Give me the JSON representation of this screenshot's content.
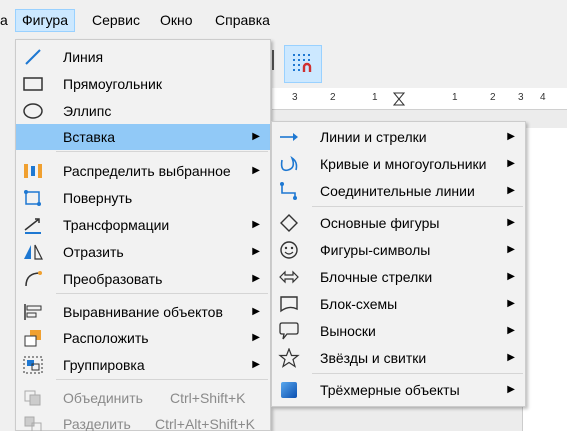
{
  "menubar": [
    "а",
    "Фигура",
    "Сервис",
    "Окно",
    "Справка"
  ],
  "toolbar": {
    "button_icon": "snap-to-grid-icon"
  },
  "ruler": {
    "labels": [
      "3",
      "2",
      "1",
      "1",
      "2",
      "3",
      "4"
    ]
  },
  "menu_shape": {
    "items": [
      {
        "label": "Линия",
        "icon": "line-icon"
      },
      {
        "label": "Прямоугольник",
        "icon": "rectangle-icon"
      },
      {
        "label": "Эллипс",
        "icon": "ellipse-icon"
      },
      {
        "label": "Вставка",
        "icon": "",
        "submenu": true,
        "highlighted": true
      },
      {
        "label": "Распределить выбранное",
        "icon": "distribute-icon",
        "submenu": true
      },
      {
        "label": "Повернуть",
        "icon": "rotate-icon"
      },
      {
        "label": "Трансформации",
        "icon": "transform-icon",
        "submenu": true
      },
      {
        "label": "Отразить",
        "icon": "flip-icon",
        "submenu": true
      },
      {
        "label": "Преобразовать",
        "icon": "convert-icon",
        "submenu": true
      },
      {
        "label": "Выравнивание объектов",
        "icon": "align-icon",
        "submenu": true
      },
      {
        "label": "Расположить",
        "icon": "arrange-icon",
        "submenu": true
      },
      {
        "label": "Группировка",
        "icon": "group-icon",
        "submenu": true
      },
      {
        "label": "Объединить",
        "shortcut": "Ctrl+Shift+K",
        "icon": "combine-icon",
        "disabled": true
      },
      {
        "label": "Разделить",
        "shortcut": "Ctrl+Alt+Shift+K",
        "icon": "split-icon",
        "disabled": true
      }
    ]
  },
  "submenu_insert": {
    "items": [
      {
        "label": "Линии и стрелки",
        "icon": "arrow-line-icon"
      },
      {
        "label": "Кривые и многоугольники",
        "icon": "curve-icon"
      },
      {
        "label": "Соединительные линии",
        "icon": "connector-icon"
      },
      {
        "label": "Основные фигуры",
        "icon": "diamond-icon"
      },
      {
        "label": "Фигуры-символы",
        "icon": "smiley-icon"
      },
      {
        "label": "Блочные стрелки",
        "icon": "block-arrow-icon"
      },
      {
        "label": "Блок-схемы",
        "icon": "flowchart-icon"
      },
      {
        "label": "Выноски",
        "icon": "callout-icon"
      },
      {
        "label": "Звёзды и свитки",
        "icon": "star-icon"
      },
      {
        "label": "Трёхмерные объекты",
        "icon": "3d-object-icon"
      }
    ]
  },
  "colors": {
    "highlight": "#91c9f7",
    "menubar_active": "#cce8ff",
    "icon_blue": "#1e78d2",
    "icon_orange": "#f0a030"
  }
}
